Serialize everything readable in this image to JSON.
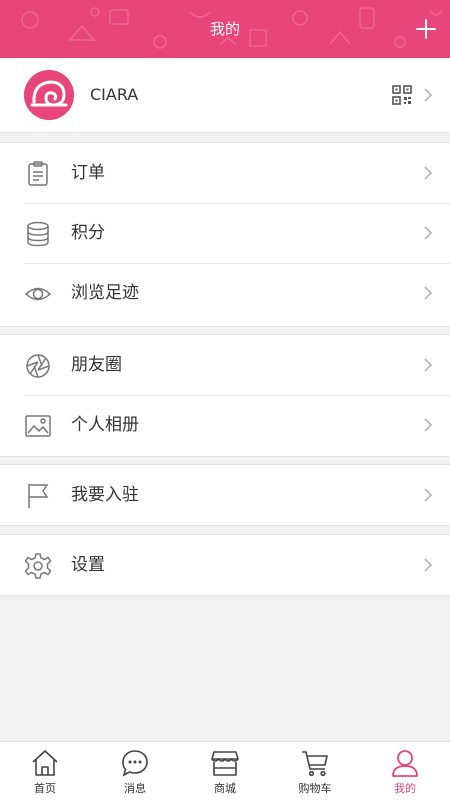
{
  "header": {
    "title": "我的"
  },
  "profile": {
    "name": "CIARA"
  },
  "groups": [
    {
      "items": [
        {
          "label": "订单",
          "icon": "clipboard-icon"
        },
        {
          "label": "积分",
          "icon": "coins-stack-icon"
        },
        {
          "label": "浏览足迹",
          "icon": "eye-icon"
        }
      ]
    },
    {
      "items": [
        {
          "label": "朋友圈",
          "icon": "aperture-icon"
        },
        {
          "label": "个人相册",
          "icon": "photo-album-icon"
        }
      ]
    },
    {
      "items": [
        {
          "label": "我要入驻",
          "icon": "flag-icon"
        }
      ]
    },
    {
      "items": [
        {
          "label": "设置",
          "icon": "gear-icon"
        }
      ]
    }
  ],
  "tabs": [
    {
      "label": "首页",
      "icon": "home-icon"
    },
    {
      "label": "消息",
      "icon": "message-bubble-icon"
    },
    {
      "label": "商城",
      "icon": "store-icon"
    },
    {
      "label": "购物车",
      "icon": "cart-icon"
    },
    {
      "label": "我的",
      "icon": "person-icon",
      "active": true
    }
  ],
  "colors": {
    "accent": "#e8457a",
    "background": "#f2f2f2"
  }
}
